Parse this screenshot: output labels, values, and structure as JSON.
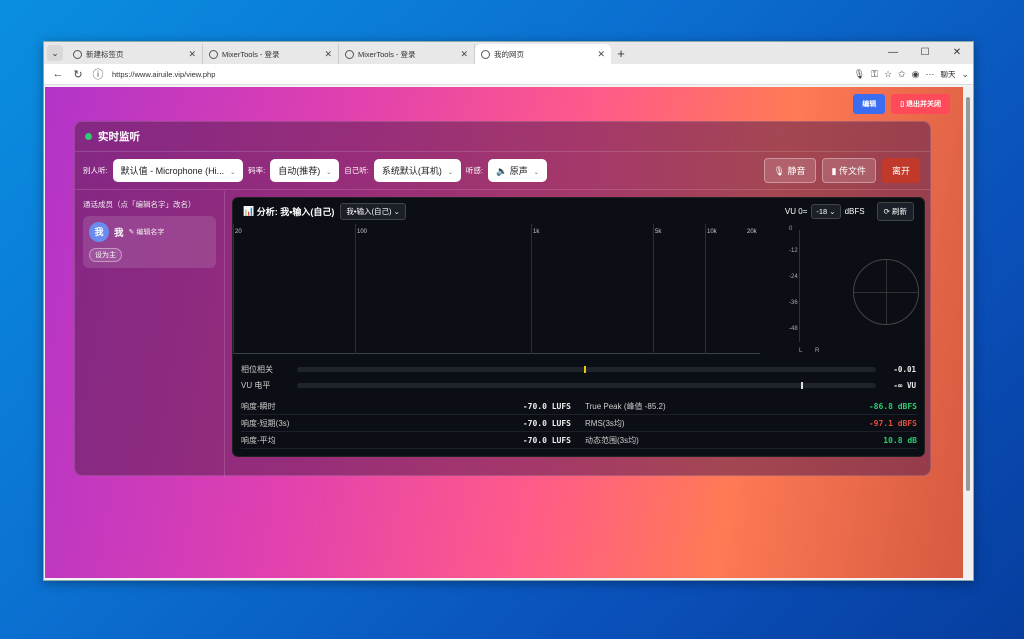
{
  "browser": {
    "tabs": [
      {
        "label": "新建标签页",
        "active": false
      },
      {
        "label": "MixerTools - 登录",
        "active": false
      },
      {
        "label": "MixerTools - 登录",
        "active": false
      },
      {
        "label": "我的网页",
        "active": true
      }
    ],
    "url": "https://www.airuile.vip/view.php",
    "chat_label": "聊天"
  },
  "page": {
    "edit_label": "编辑",
    "exit_label": "▯ 退出并关闭",
    "panel_title": "实时监听",
    "controls": {
      "others_label": "别人听:",
      "others_value": "默认值 - Microphone (Hi...",
      "codec_label": "码率:",
      "codec_value": "自动(推荐)",
      "self_label": "自己听:",
      "self_value": "系统默认(耳机)",
      "monitor_label": "听感:",
      "monitor_value": "原声",
      "mute_label": "静音",
      "upload_label": "传文件",
      "leave_label": "离开"
    },
    "members": {
      "title": "通话成员（点「编辑名字」改名）",
      "items": [
        {
          "avatar": "我",
          "name": "我",
          "edit": "编辑名字",
          "host": "设为主"
        }
      ]
    },
    "analysis": {
      "title": "分析: 我•输入(自己)",
      "select": "我•输入(自己)",
      "vu_label": "VU 0=",
      "vu_value": "-18",
      "vu_unit": "dBFS",
      "refresh": "刷新",
      "freq_labels": [
        "20",
        "100",
        "1k",
        "5k",
        "10k",
        "20k"
      ],
      "db_labels": [
        "0",
        "-12",
        "-24",
        "-36",
        "-48"
      ],
      "lr": [
        "L",
        "R"
      ],
      "phase_label": "相位相关",
      "phase_value": "-0.01",
      "phase_position": 0.495,
      "vu_row_label": "VU 电平",
      "vu_row_value": "-∞ VU",
      "vu_position": 0.87,
      "stats": [
        {
          "l1": "响度-瞬时",
          "v1": "-70.0 LUFS",
          "l2": "True Peak (峰值 -85.2)",
          "v2": "-86.8 dBFS",
          "c2": "#2ecc71"
        },
        {
          "l1": "响度-短期(3s)",
          "v1": "-70.0 LUFS",
          "l2": "RMS(3s均)",
          "v2": "-97.1 dBFS",
          "c2": "#e74c3c"
        },
        {
          "l1": "响度-平均",
          "v1": "-70.0 LUFS",
          "l2": "动态范围(3s均)",
          "v2": "10.8 dB",
          "c2": "#2ecc71"
        }
      ]
    }
  }
}
